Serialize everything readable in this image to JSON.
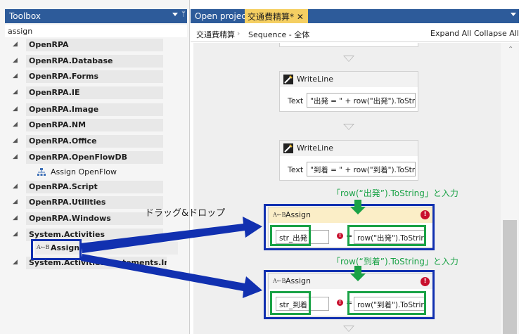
{
  "toolbox": {
    "title": "Toolbox",
    "search_value": "assign",
    "categories": [
      {
        "label": "OpenRPA"
      },
      {
        "label": "OpenRPA.Database"
      },
      {
        "label": "OpenRPA.Forms"
      },
      {
        "label": "OpenRPA.IE"
      },
      {
        "label": "OpenRPA.Image"
      },
      {
        "label": "OpenRPA.NM"
      },
      {
        "label": "OpenRPA.Office"
      },
      {
        "label": "OpenRPA.OpenFlowDB",
        "tool": "Assign OpenFlow"
      },
      {
        "label": "OpenRPA.Script"
      },
      {
        "label": "OpenRPA.Utilities"
      },
      {
        "label": "OpenRPA.Windows"
      },
      {
        "label": "System.Activities",
        "tool": "Assign"
      },
      {
        "label": "System.Activities.Statements.Interaction"
      }
    ]
  },
  "designer": {
    "tabs": [
      "Open project",
      "交通費精算*"
    ],
    "tab_close_glyph": "✕",
    "breadcrumb": [
      "交通費精算",
      "Sequence - 全体"
    ],
    "breadcrumb_sep": "›",
    "expand_all": "Expand All",
    "collapse_all": "Collapse All",
    "writelines": [
      {
        "title": "WriteLine",
        "label": "Text",
        "expr": "\"出発 = \" + row(\"出発\").ToStr"
      },
      {
        "title": "WriteLine",
        "label": "Text",
        "expr": "\"到着 = \" + row(\"到着\").ToStr"
      }
    ],
    "assigns": [
      {
        "title": "Assign",
        "to": "str_出発",
        "eq": "=",
        "value": "row(\"出発\").ToStrir",
        "error": "!"
      },
      {
        "title": "Assign",
        "to": "str_到着",
        "eq": "=",
        "value": "row(\"到着\").ToStrir",
        "error": "!"
      }
    ]
  },
  "annotations": {
    "drag_drop": "ドラッグ&ドロップ",
    "note_1": "「row(“出発”).ToString」と入力",
    "note_2": "「row(“到着”).ToString」と入力"
  },
  "colors": {
    "header_blue": "#2d5b9a",
    "active_tab": "#f5cf62",
    "annotation_blue": "#1130b0",
    "annotation_green": "#1aa246",
    "error_red": "#c8102e"
  }
}
